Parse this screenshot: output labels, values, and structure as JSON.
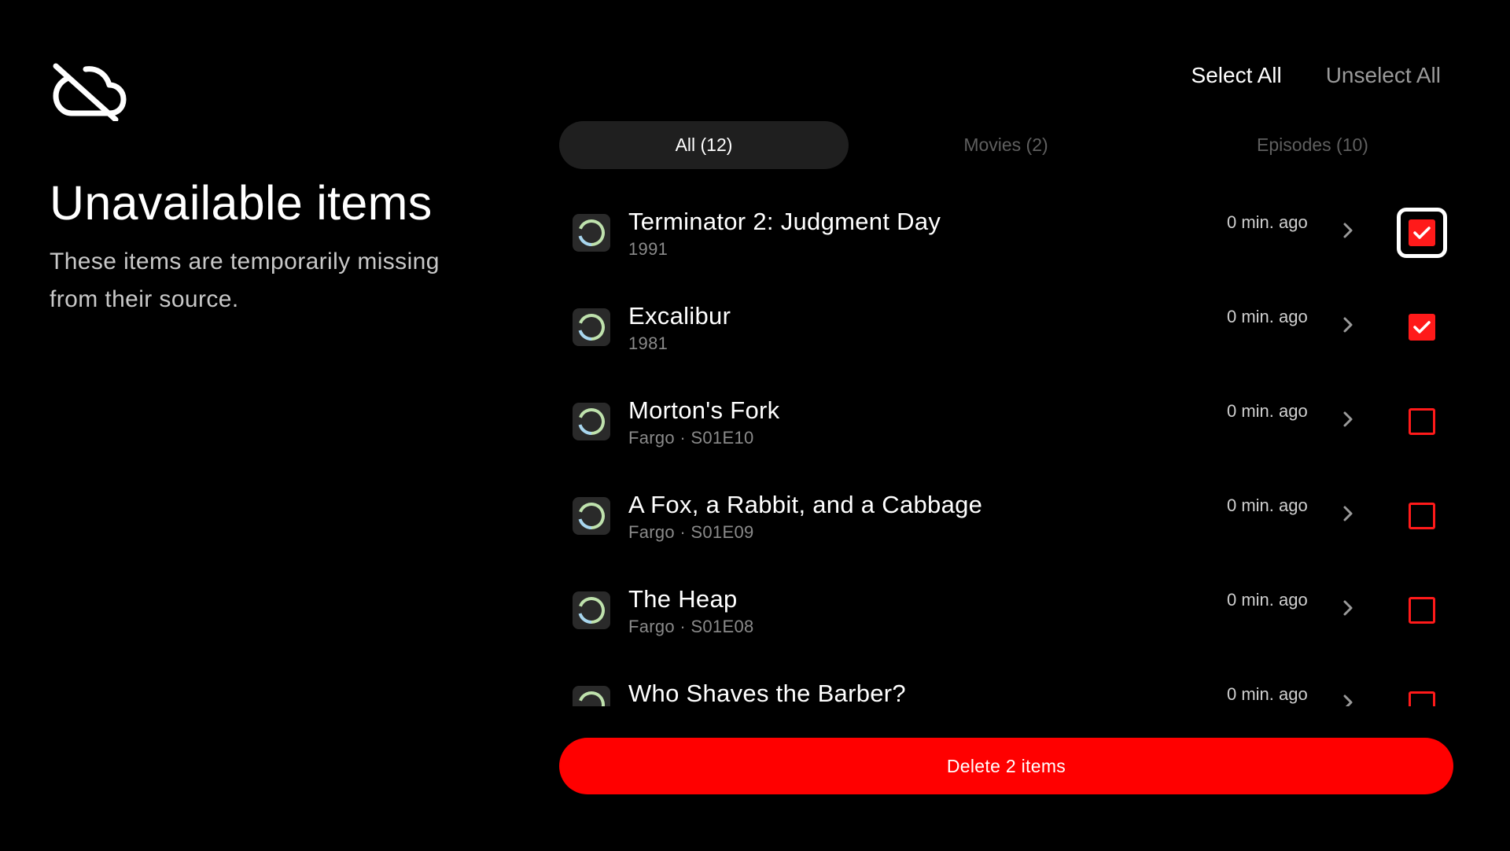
{
  "header": {
    "title": "Unavailable items",
    "subtitle_line1": "These items are temporarily missing",
    "subtitle_line2": "from their source.",
    "icon": "cloud-off-icon"
  },
  "actions": {
    "select_all": "Select All",
    "unselect_all": "Unselect All"
  },
  "tabs": [
    {
      "label": "All (12)",
      "active": true
    },
    {
      "label": "Movies (2)",
      "active": false
    },
    {
      "label": "Episodes (10)",
      "active": false
    }
  ],
  "items": [
    {
      "title": "Terminator 2: Judgment Day",
      "subtitle": "1991",
      "time": "0 min. ago",
      "checked": true,
      "focused": true
    },
    {
      "title": "Excalibur",
      "subtitle": "1981",
      "time": "0 min. ago",
      "checked": true,
      "focused": false
    },
    {
      "title": "Morton's Fork",
      "subtitle": "Fargo · S01E10",
      "time": "0 min. ago",
      "checked": false,
      "focused": false
    },
    {
      "title": "A Fox, a Rabbit, and a Cabbage",
      "subtitle": "Fargo · S01E09",
      "time": "0 min. ago",
      "checked": false,
      "focused": false
    },
    {
      "title": "The Heap",
      "subtitle": "Fargo · S01E08",
      "time": "0 min. ago",
      "checked": false,
      "focused": false
    },
    {
      "title": "Who Shaves the Barber?",
      "subtitle": "",
      "time": "0 min. ago",
      "checked": false,
      "focused": false
    }
  ],
  "delete_button": {
    "label": "Delete 2 items"
  },
  "colors": {
    "accent": "#ff0000",
    "background": "#000000",
    "tab_active_bg": "#1f1f1f"
  }
}
